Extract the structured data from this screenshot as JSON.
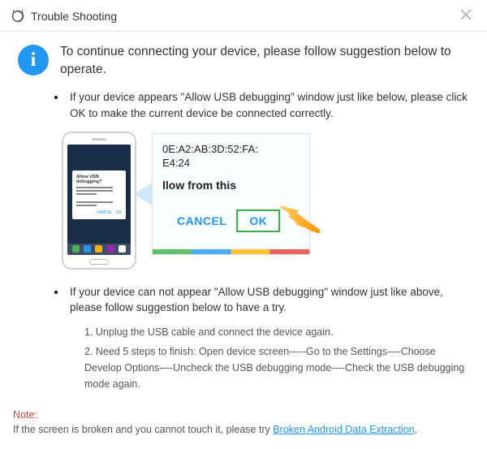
{
  "window": {
    "title": "Trouble Shooting"
  },
  "info_icon_glyph": "i",
  "main_instruction": "To continue connecting your device, please follow suggestion below to operate.",
  "bullets": [
    {
      "text": "If your device appears \"Allow USB debugging\" window just like below, please click OK to make the current device  be connected correctly."
    },
    {
      "text": "If your device can not appear \"Allow USB debugging\" window just like above, please follow suggestion below to have a try.",
      "steps": [
        "1. Unplug the USB cable and connect the device again.",
        "2. Need 5 steps to finish: Open device screen-----Go to the Settings----Choose Develop Options----Uncheck the USB debugging mode----Check the USB debugging mode again."
      ]
    }
  ],
  "phone_dialog": {
    "title": "Allow USB debugging?",
    "cancel": "CANCEL",
    "ok": "OK"
  },
  "zoom": {
    "mac_line1": "0E:A2:AB:3D:52:FA:",
    "mac_line2": "E4:24",
    "prompt_fragment": "llow from this",
    "cancel": "CANCEL",
    "ok": "OK"
  },
  "note": {
    "label": "Note:",
    "text": "If the screen is broken and you cannot touch it, please try ",
    "link": "Broken Android Data Extraction",
    "suffix": "."
  }
}
